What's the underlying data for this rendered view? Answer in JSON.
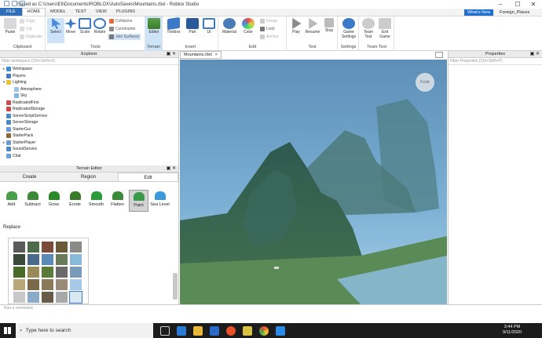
{
  "window": {
    "title": "Saved as C:\\Users\\Eli\\Documents\\ROBLOX\\AutoSaves\\Mountains.rbxl - Roblox Studio"
  },
  "menu_tabs": [
    "FILE",
    "HOME",
    "MODEL",
    "TEST",
    "VIEW",
    "PLUGINS"
  ],
  "active_tab": "HOME",
  "whats_new": "What's New",
  "username": "Foreign_Places",
  "ribbon": {
    "clipboard": {
      "label": "Clipboard",
      "paste": "Paste",
      "copy": "Copy",
      "cut": "Cut",
      "duplicate": "Duplicate"
    },
    "tools": {
      "label": "Tools",
      "select": "Select",
      "move": "Move",
      "scale": "Scale",
      "rotate": "Rotate",
      "collisions": "Collisions",
      "constraints": "Constraints",
      "join_surfaces": "Join Surfaces"
    },
    "terrain": {
      "label": "Terrain",
      "editor": "Editor"
    },
    "insert": {
      "label": "Insert",
      "toolbox": "Toolbox",
      "part": "Part",
      "ui": "UI"
    },
    "edit": {
      "label": "Edit",
      "material": "Material",
      "color": "Color",
      "group": "Group",
      "lock": "Lock",
      "anchor": "Anchor"
    },
    "test": {
      "label": "Test",
      "play": "Play",
      "resume": "Resume",
      "stop": "Stop"
    },
    "settings": {
      "label": "Settings",
      "game_settings": "Game Settings"
    },
    "team_test": {
      "label": "Team Test",
      "team_test": "Team Test",
      "exit_game": "Exit Game"
    }
  },
  "explorer": {
    "title": "Explorer",
    "filter_placeholder": "Filter workspace (Ctrl+Shift+X)",
    "items": [
      {
        "label": "Workspace",
        "arrow": "▸",
        "indent": 0,
        "color": "#3a8ed8"
      },
      {
        "label": "Players",
        "arrow": "",
        "indent": 0,
        "color": "#4a7ab8"
      },
      {
        "label": "Lighting",
        "arrow": "▾",
        "indent": 0,
        "color": "#e8c23a"
      },
      {
        "label": "Atmosphere",
        "arrow": "",
        "indent": 1,
        "color": "#9ac3e6"
      },
      {
        "label": "Sky",
        "arrow": "",
        "indent": 1,
        "color": "#7fb6e8"
      },
      {
        "label": "ReplicatedFirst",
        "arrow": "",
        "indent": 0,
        "color": "#c94a4a"
      },
      {
        "label": "ReplicatedStorage",
        "arrow": "",
        "indent": 0,
        "color": "#c94a4a"
      },
      {
        "label": "ServerScriptService",
        "arrow": "",
        "indent": 0,
        "color": "#4a8ac9"
      },
      {
        "label": "ServerStorage",
        "arrow": "",
        "indent": 0,
        "color": "#4a8ac9"
      },
      {
        "label": "StarterGui",
        "arrow": "",
        "indent": 0,
        "color": "#6a9ad0"
      },
      {
        "label": "StarterPack",
        "arrow": "",
        "indent": 0,
        "color": "#8a6a3a"
      },
      {
        "label": "StarterPlayer",
        "arrow": "▸",
        "indent": 0,
        "color": "#6a9ad0"
      },
      {
        "label": "SoundService",
        "arrow": "",
        "indent": 0,
        "color": "#4a8ac9"
      },
      {
        "label": "Chat",
        "arrow": "",
        "indent": 0,
        "color": "#6aa0d8"
      }
    ]
  },
  "terrain_editor": {
    "title": "Terrain Editor",
    "tabs": [
      "Create",
      "Region",
      "Edit"
    ],
    "active_tab": "Edit",
    "tools": [
      "Add",
      "Subtract",
      "Grow",
      "Erode",
      "Smooth",
      "Flatten",
      "Paint",
      "Sea Level"
    ],
    "active_tool": "Paint",
    "replace_label": "Replace",
    "materials": [
      "#5a5a5a",
      "#4d6b4a",
      "#7a4a3a",
      "#6a5a3a",
      "#8a8a86",
      "#3a4a3a",
      "#4a6a8a",
      "#5a8ab8",
      "#6a7a5a",
      "#8ab8d8",
      "#4a6a2a",
      "#9a8a5a",
      "#5a7a3a",
      "#6a6a6a",
      "#7a9aba",
      "#b8a878",
      "#7a6a4a",
      "#8a7a5a",
      "#9a8a7a",
      "#a8c8e8",
      "#c8c8c8",
      "#8aaac8",
      "#6a5a4a",
      "#a8a8a8",
      "#d8e8f0",
      "#8ab8e0",
      "#d8b878"
    ]
  },
  "viewport": {
    "tab_label": "Mountains.rbxl",
    "tab_close": "×",
    "view_cube": "Front"
  },
  "properties": {
    "title": "Properties",
    "filter_placeholder": "Filter Properties (Ctrl+Shift+P)"
  },
  "command_bar": {
    "placeholder": "Run a command"
  },
  "taskbar": {
    "search_placeholder": "Type here to search",
    "time": "3:44 PM",
    "date": "9/11/2020"
  }
}
